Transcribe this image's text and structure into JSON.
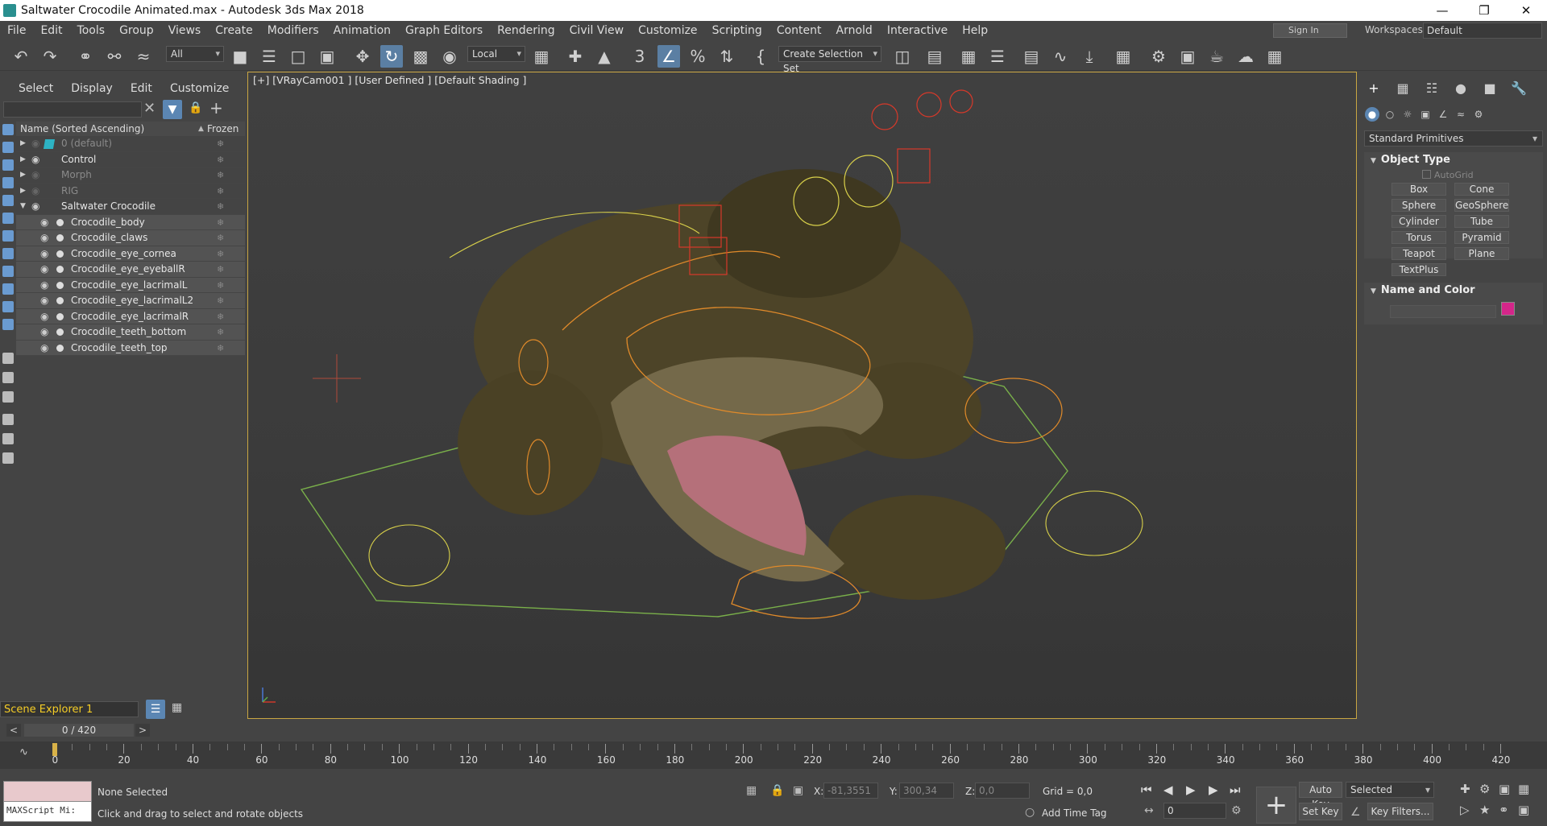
{
  "window": {
    "title": "Saltwater Crocodile Animated.max - Autodesk 3ds Max 2018"
  },
  "menu": [
    "File",
    "Edit",
    "Tools",
    "Group",
    "Views",
    "Create",
    "Modifiers",
    "Animation",
    "Graph Editors",
    "Rendering",
    "Civil View",
    "Customize",
    "Scripting",
    "Content",
    "Arnold",
    "Interactive",
    "Help"
  ],
  "account": {
    "sign_in": "Sign In",
    "workspaces_label": "Workspaces:",
    "workspace": "Default"
  },
  "toolbar": {
    "selection_filter": "All",
    "coordinate_system": "Local",
    "selection_set": "Create Selection Set"
  },
  "scene_explorer": {
    "tabs": [
      "Select",
      "Display",
      "Edit",
      "Customize"
    ],
    "column_name": "Name (Sorted Ascending)",
    "column_frozen": "Frozen",
    "rows": [
      {
        "label": "0 (default)",
        "type": "layer",
        "dim": true
      },
      {
        "label": "Control",
        "type": "layer",
        "dim": false
      },
      {
        "label": "Morph",
        "type": "layer",
        "dim": true
      },
      {
        "label": "RIG",
        "type": "layer",
        "dim": true
      },
      {
        "label": "Saltwater Crocodile",
        "type": "layer",
        "dim": false
      },
      {
        "label": "Crocodile_body",
        "type": "object",
        "dim": false
      },
      {
        "label": "Crocodile_claws",
        "type": "object",
        "dim": false
      },
      {
        "label": "Crocodile_eye_cornea",
        "type": "object",
        "dim": false
      },
      {
        "label": "Crocodile_eye_eyeballR",
        "type": "object",
        "dim": false
      },
      {
        "label": "Crocodile_eye_lacrimalL",
        "type": "object",
        "dim": false
      },
      {
        "label": "Crocodile_eye_lacrimalL2",
        "type": "object",
        "dim": false
      },
      {
        "label": "Crocodile_eye_lacrimalR",
        "type": "object",
        "dim": false
      },
      {
        "label": "Crocodile_teeth_bottom",
        "type": "object",
        "dim": false
      },
      {
        "label": "Crocodile_teeth_top",
        "type": "object",
        "dim": false
      }
    ],
    "footer_name": "Scene Explorer 1"
  },
  "viewport": {
    "label": "[+] [VRayCam001 ] [User Defined ] [Default Shading ]"
  },
  "command_panel": {
    "category": "Standard Primitives",
    "object_type_title": "Object Type",
    "autogrid": "AutoGrid",
    "primitives": [
      "Box",
      "Cone",
      "Sphere",
      "GeoSphere",
      "Cylinder",
      "Tube",
      "Torus",
      "Pyramid",
      "Teapot",
      "Plane",
      "TextPlus"
    ],
    "name_color_title": "Name and Color",
    "object_color": "#d4268a"
  },
  "timeline": {
    "frame_display": "0 / 420",
    "current_frame": 0,
    "total_frames": 420,
    "tick_labels": [
      "0",
      "20",
      "40",
      "60",
      "80",
      "100",
      "120",
      "140",
      "160",
      "180",
      "200",
      "220",
      "240",
      "260",
      "280",
      "300",
      "320",
      "340",
      "360",
      "380",
      "400",
      "420"
    ]
  },
  "status": {
    "maxscript": "MAXScript Mi:",
    "selection": "None Selected",
    "prompt": "Click and drag to select and rotate objects",
    "x_label": "X:",
    "x_value": "-81,3551",
    "y_label": "Y:",
    "y_value": "300,34",
    "z_label": "Z:",
    "z_value": "0,0",
    "grid": "Grid = 0,0",
    "add_time_tag": "Add Time Tag",
    "auto_key": "Auto Key",
    "set_key": "Set Key",
    "key_mode": "Selected",
    "key_filters": "Key Filters...",
    "frame_field": "0"
  }
}
